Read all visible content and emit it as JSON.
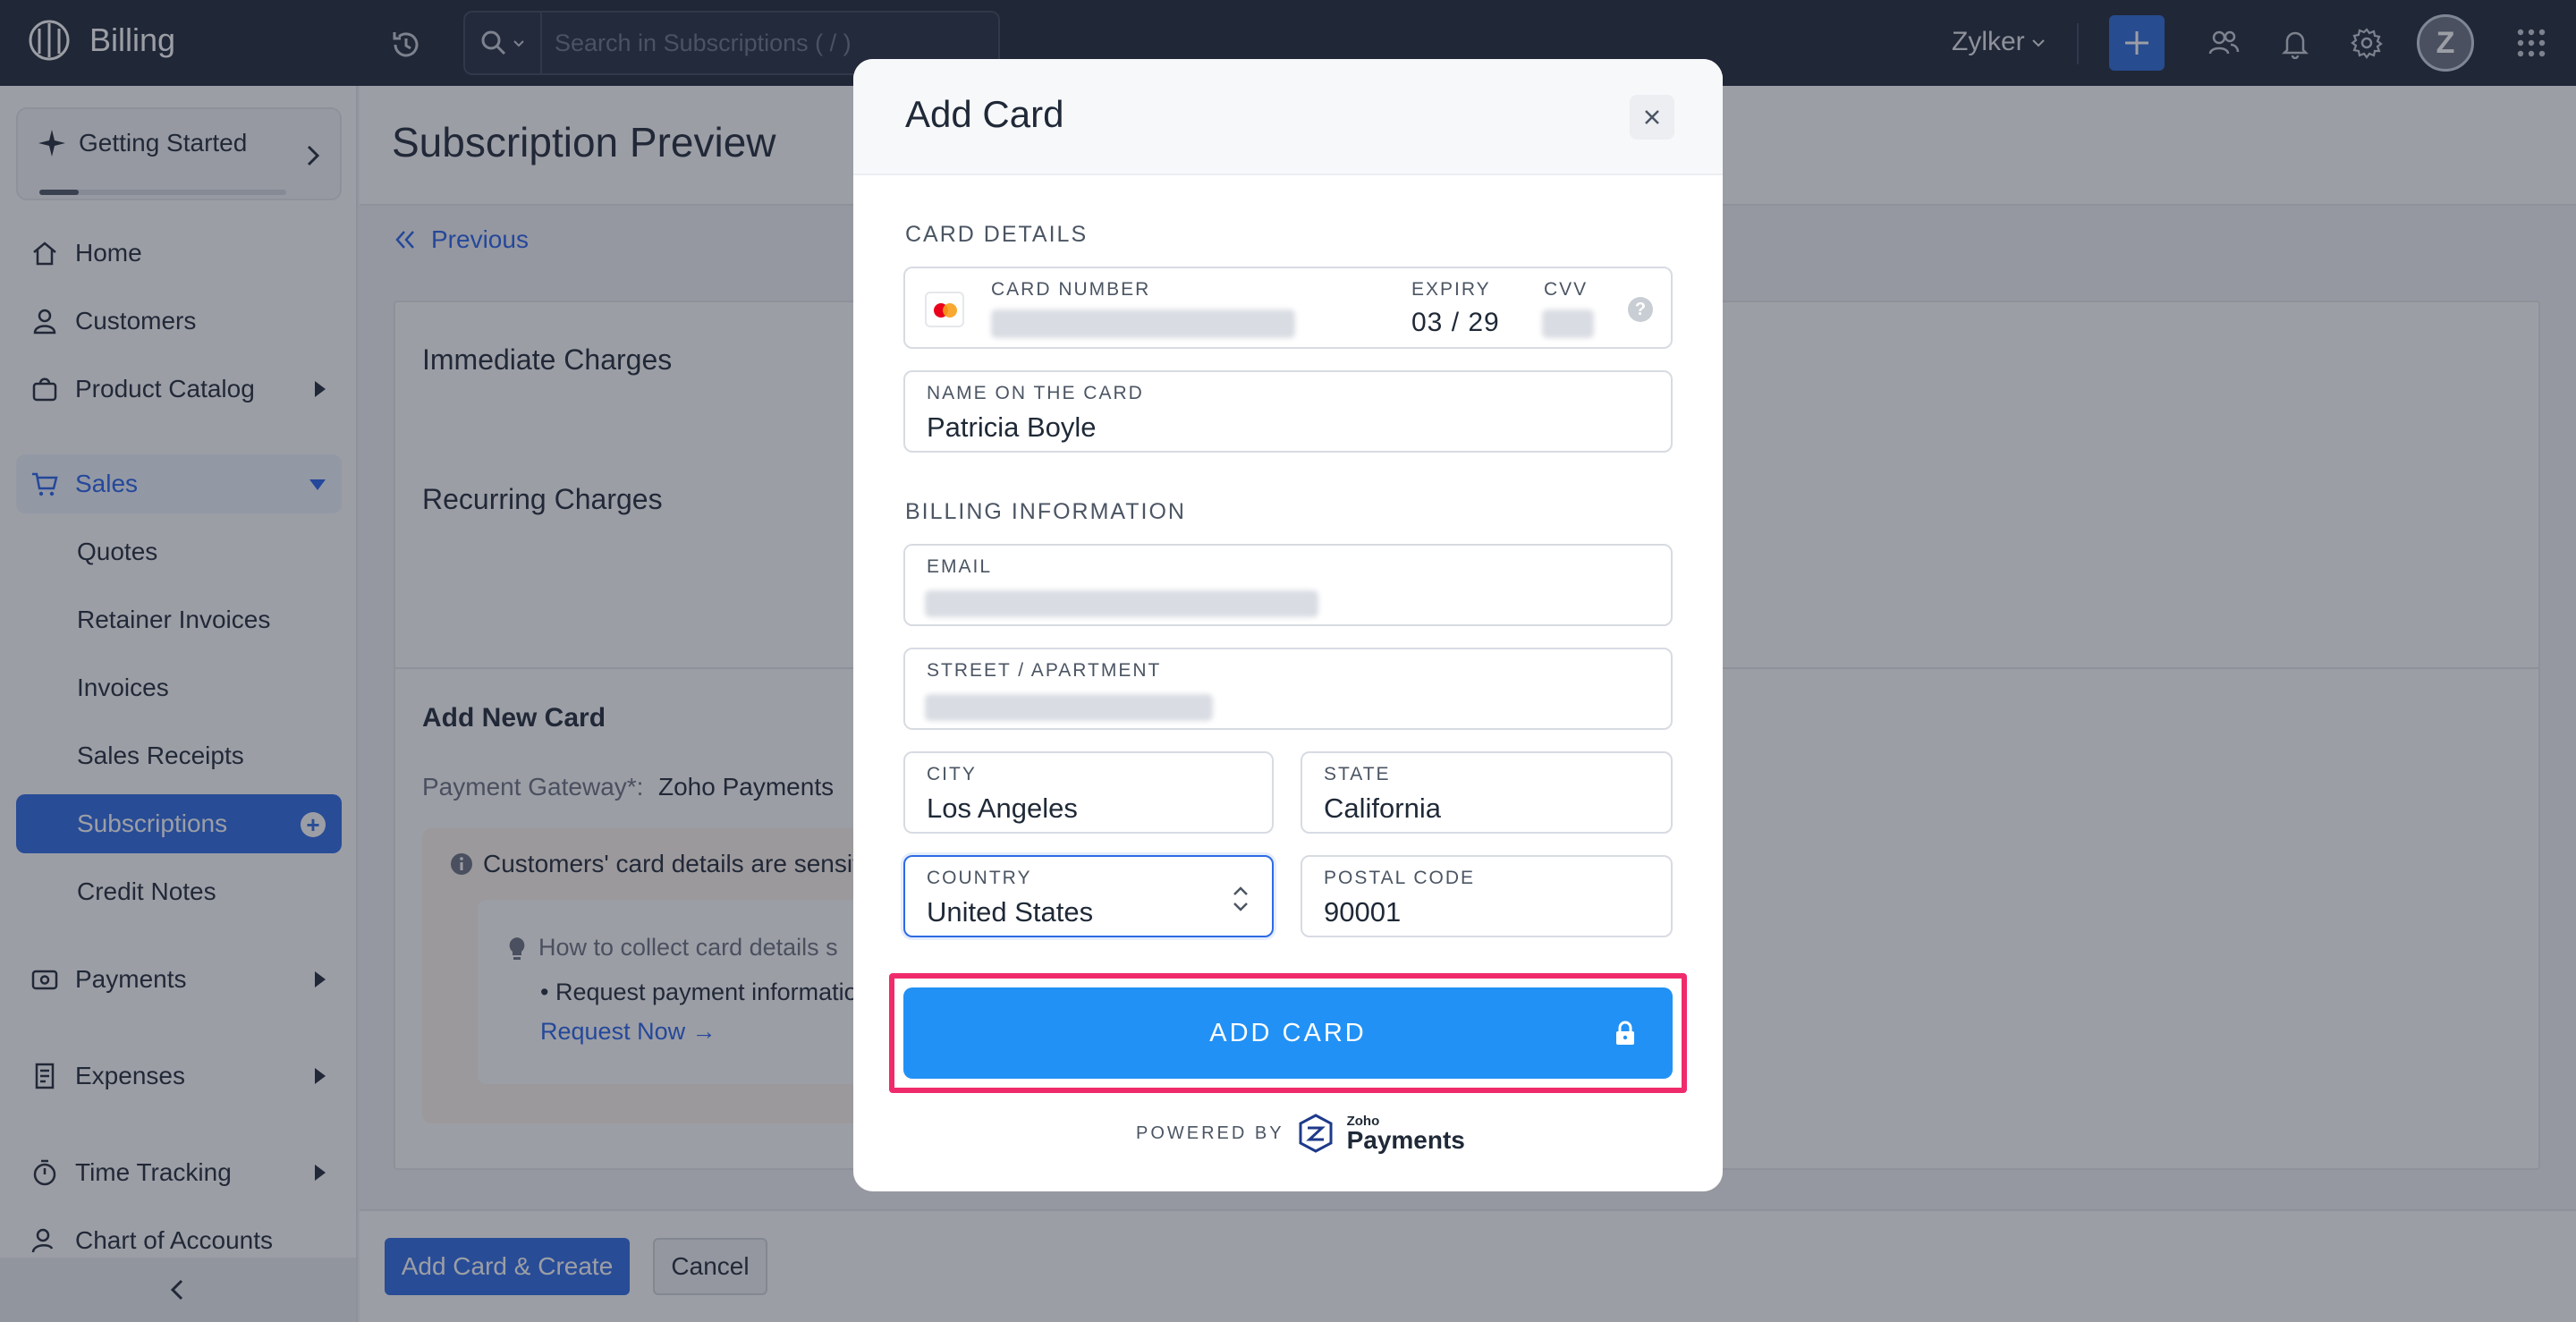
{
  "app": {
    "title": "Billing"
  },
  "topbar": {
    "search_placeholder": "Search in Subscriptions ( / )",
    "org_name": "Zylker",
    "avatar_initial": "Z"
  },
  "sidebar": {
    "getting_started": {
      "label": "Getting Started",
      "progress": 0.16
    },
    "items": [
      {
        "label": "Home"
      },
      {
        "label": "Customers"
      },
      {
        "label": "Product Catalog"
      },
      {
        "label": "Sales"
      },
      {
        "label": "Payments"
      },
      {
        "label": "Expenses"
      },
      {
        "label": "Time Tracking"
      },
      {
        "label": "Chart of Accounts"
      }
    ],
    "sales_sub": [
      {
        "label": "Quotes"
      },
      {
        "label": "Retainer Invoices"
      },
      {
        "label": "Invoices"
      },
      {
        "label": "Sales Receipts"
      },
      {
        "label": "Subscriptions"
      },
      {
        "label": "Credit Notes"
      }
    ]
  },
  "main": {
    "page_title": "Subscription Preview",
    "previous_link": "Previous",
    "immediate_charges": "Immediate Charges",
    "recurring_charges": "Recurring Charges",
    "add_new_card": "Add New Card",
    "payment_gateway_label": "Payment Gateway*:",
    "payment_gateway_value": "Zoho Payments",
    "info_text": "Customers' card details are sensit",
    "howto_text": "How to collect card details s",
    "bullet_text": "Request payment information",
    "request_now": "Request Now →"
  },
  "footer": {
    "primary_label": "Add Card & Create",
    "cancel_label": "Cancel"
  },
  "modal": {
    "title": "Add Card",
    "card_details_title": "CARD DETAILS",
    "card_number_label": "CARD NUMBER",
    "expiry_label": "EXPIRY",
    "expiry_value": "03 / 29",
    "cvv_label": "CVV",
    "help": "?",
    "name_label": "NAME ON THE CARD",
    "name_value": "Patricia Boyle",
    "billing_title": "BILLING INFORMATION",
    "email_label": "EMAIL",
    "street_label": "STREET / APARTMENT",
    "city_label": "CITY",
    "city_value": "Los Angeles",
    "state_label": "STATE",
    "state_value": "California",
    "country_label": "COUNTRY",
    "country_value": "United States",
    "postal_label": "POSTAL CODE",
    "postal_value": "90001",
    "add_card_button": "ADD CARD",
    "powered_by": "POWERED BY",
    "brand_small": "Zoho",
    "brand_large": "Payments"
  },
  "colors": {
    "topbar": "#1e2738",
    "accent": "#2d6be4",
    "add_card_button": "#2291f5",
    "highlight": "#ef2b6c"
  }
}
